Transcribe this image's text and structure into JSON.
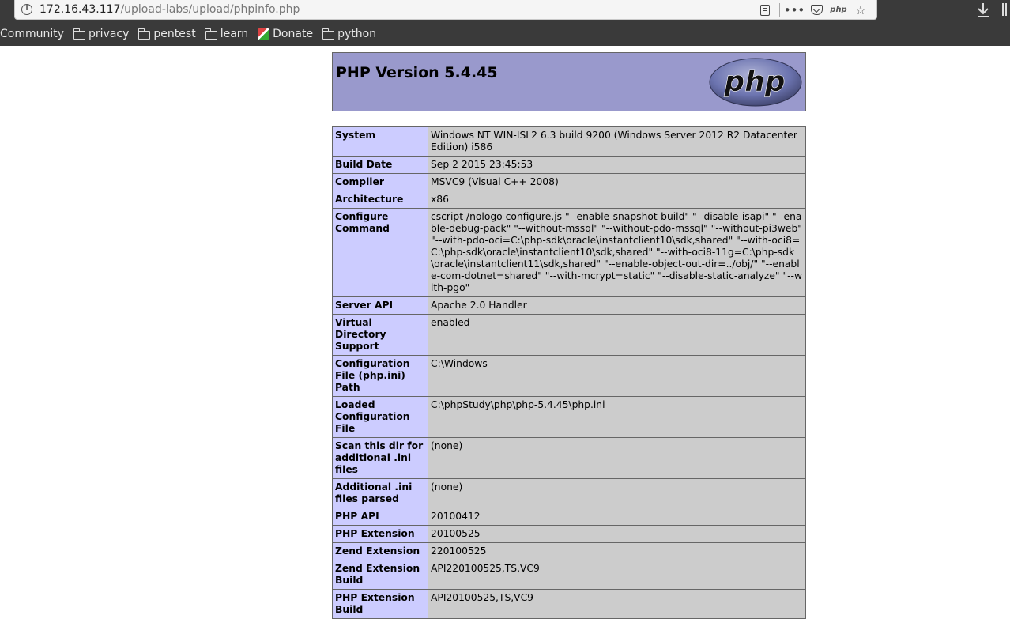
{
  "browser": {
    "url_host": "172.16.43.117",
    "url_path": "/upload-labs/upload/phpinfo.php",
    "php_extension_label": "php"
  },
  "bookmarks": [
    {
      "label": "Community",
      "icon": "none"
    },
    {
      "label": "privacy",
      "icon": "folder-icon"
    },
    {
      "label": "pentest",
      "icon": "folder-icon"
    },
    {
      "label": "learn",
      "icon": "folder-icon"
    },
    {
      "label": "Donate",
      "icon": "donate-icon"
    },
    {
      "label": "python",
      "icon": "folder-icon"
    }
  ],
  "phpinfo": {
    "version_title": "PHP Version 5.4.45",
    "logo_text": "php",
    "rows": [
      {
        "key": "System",
        "value": "Windows NT WIN-ISL2 6.3 build 9200 (Windows Server 2012 R2 Datacenter Edition) i586"
      },
      {
        "key": "Build Date",
        "value": "Sep 2 2015 23:45:53"
      },
      {
        "key": "Compiler",
        "value": "MSVC9 (Visual C++ 2008)"
      },
      {
        "key": "Architecture",
        "value": "x86"
      },
      {
        "key": "Configure Command",
        "value": "cscript /nologo configure.js \"--enable-snapshot-build\" \"--disable-isapi\" \"--enable-debug-pack\" \"--without-mssql\" \"--without-pdo-mssql\" \"--without-pi3web\" \"--with-pdo-oci=C:\\php-sdk\\oracle\\instantclient10\\sdk,shared\" \"--with-oci8=C:\\php-sdk\\oracle\\instantclient10\\sdk,shared\" \"--with-oci8-11g=C:\\php-sdk\\oracle\\instantclient11\\sdk,shared\" \"--enable-object-out-dir=../obj/\" \"--enable-com-dotnet=shared\" \"--with-mcrypt=static\" \"--disable-static-analyze\" \"--with-pgo\""
      },
      {
        "key": "Server API",
        "value": "Apache 2.0 Handler"
      },
      {
        "key": "Virtual Directory Support",
        "value": "enabled"
      },
      {
        "key": "Configuration File (php.ini) Path",
        "value": "C:\\Windows"
      },
      {
        "key": "Loaded Configuration File",
        "value": "C:\\phpStudy\\php\\php-5.4.45\\php.ini"
      },
      {
        "key": "Scan this dir for additional .ini files",
        "value": "(none)"
      },
      {
        "key": "Additional .ini files parsed",
        "value": "(none)"
      },
      {
        "key": "PHP API",
        "value": "20100412"
      },
      {
        "key": "PHP Extension",
        "value": "20100525"
      },
      {
        "key": "Zend Extension",
        "value": "220100525"
      },
      {
        "key": "Zend Extension Build",
        "value": "API220100525,TS,VC9"
      },
      {
        "key": "PHP Extension Build",
        "value": "API20100525,TS,VC9"
      }
    ]
  }
}
